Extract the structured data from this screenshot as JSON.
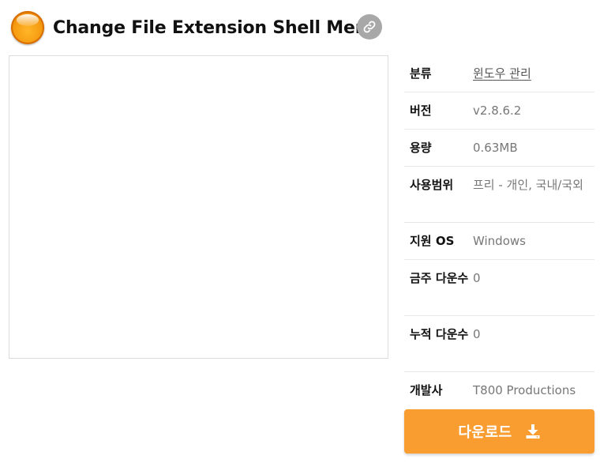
{
  "app": {
    "title": "Change File Extension Shell Menu",
    "icon": "orange-orb-icon",
    "share_icon": "link-icon"
  },
  "info": {
    "category_label": "분류",
    "category_value": "윈도우 관리",
    "version_label": "버전",
    "version_value": "v2.8.6.2",
    "size_label": "용량",
    "size_value": "0.63MB",
    "license_label": "사용범위",
    "license_value": "프리 - 개인, 국내/국외",
    "os_label": "지원 OS",
    "os_value": "Windows",
    "weekly_label": "금주 다운수",
    "weekly_value": "0",
    "total_label": "누적 다운수",
    "total_value": "0",
    "developer_label": "개발사",
    "developer_value": "T800 Productions"
  },
  "download": {
    "label": "다운로드",
    "icon": "download-icon"
  },
  "colors": {
    "accent": "#f99d31",
    "share_button": "#a8a8a8"
  }
}
